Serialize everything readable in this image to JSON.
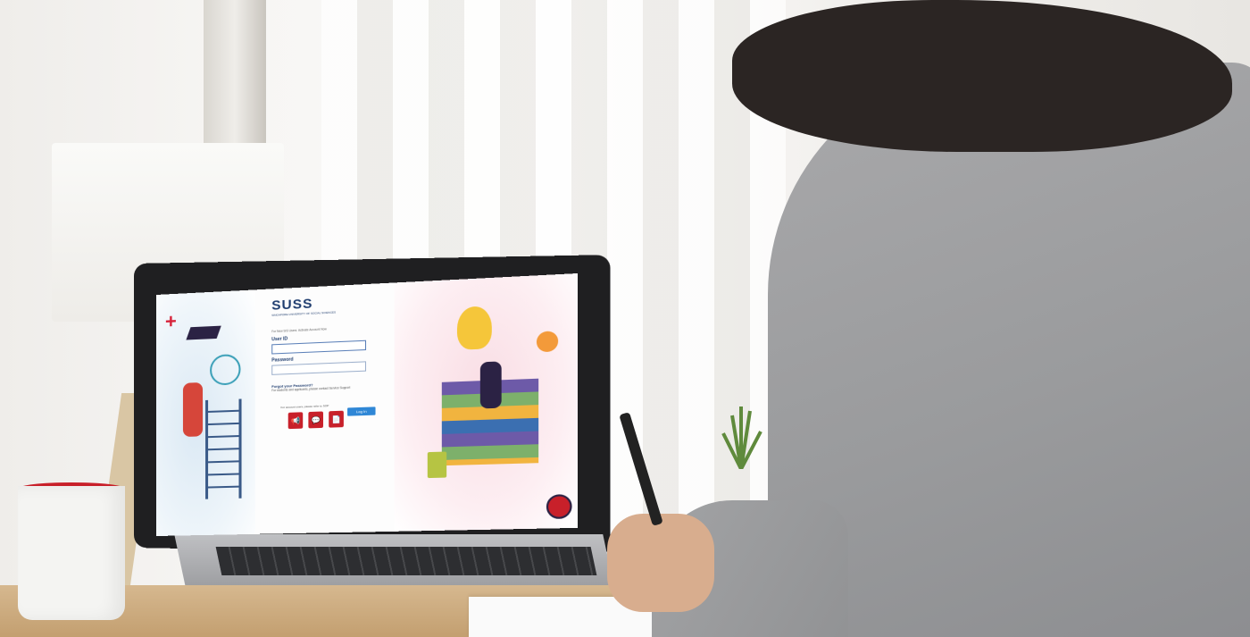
{
  "login_page": {
    "logo": "SUSS",
    "logo_subtitle": "SINGAPORE UNIVERSITY OF SOCIAL SCIENCES",
    "hint_text": "For New SIS Users: Activate Account Now",
    "user_id_label": "User ID",
    "user_id_value": "",
    "password_label": "Password",
    "password_value": "",
    "forgot_password_title": "Forgot your Password?",
    "forgot_password_note": "For students and applicants, please contact Service Support",
    "login_button": "Log In",
    "links_note": "For account users, please refer to SOP",
    "quick_links": [
      {
        "icon": "megaphone-icon",
        "glyph": "📢"
      },
      {
        "icon": "chat-icon",
        "glyph": "💬"
      },
      {
        "icon": "document-icon",
        "glyph": "📄"
      }
    ]
  },
  "colors": {
    "brand_blue": "#1e3c6e",
    "button_blue": "#2f87d6",
    "accent_red": "#c8202a"
  }
}
